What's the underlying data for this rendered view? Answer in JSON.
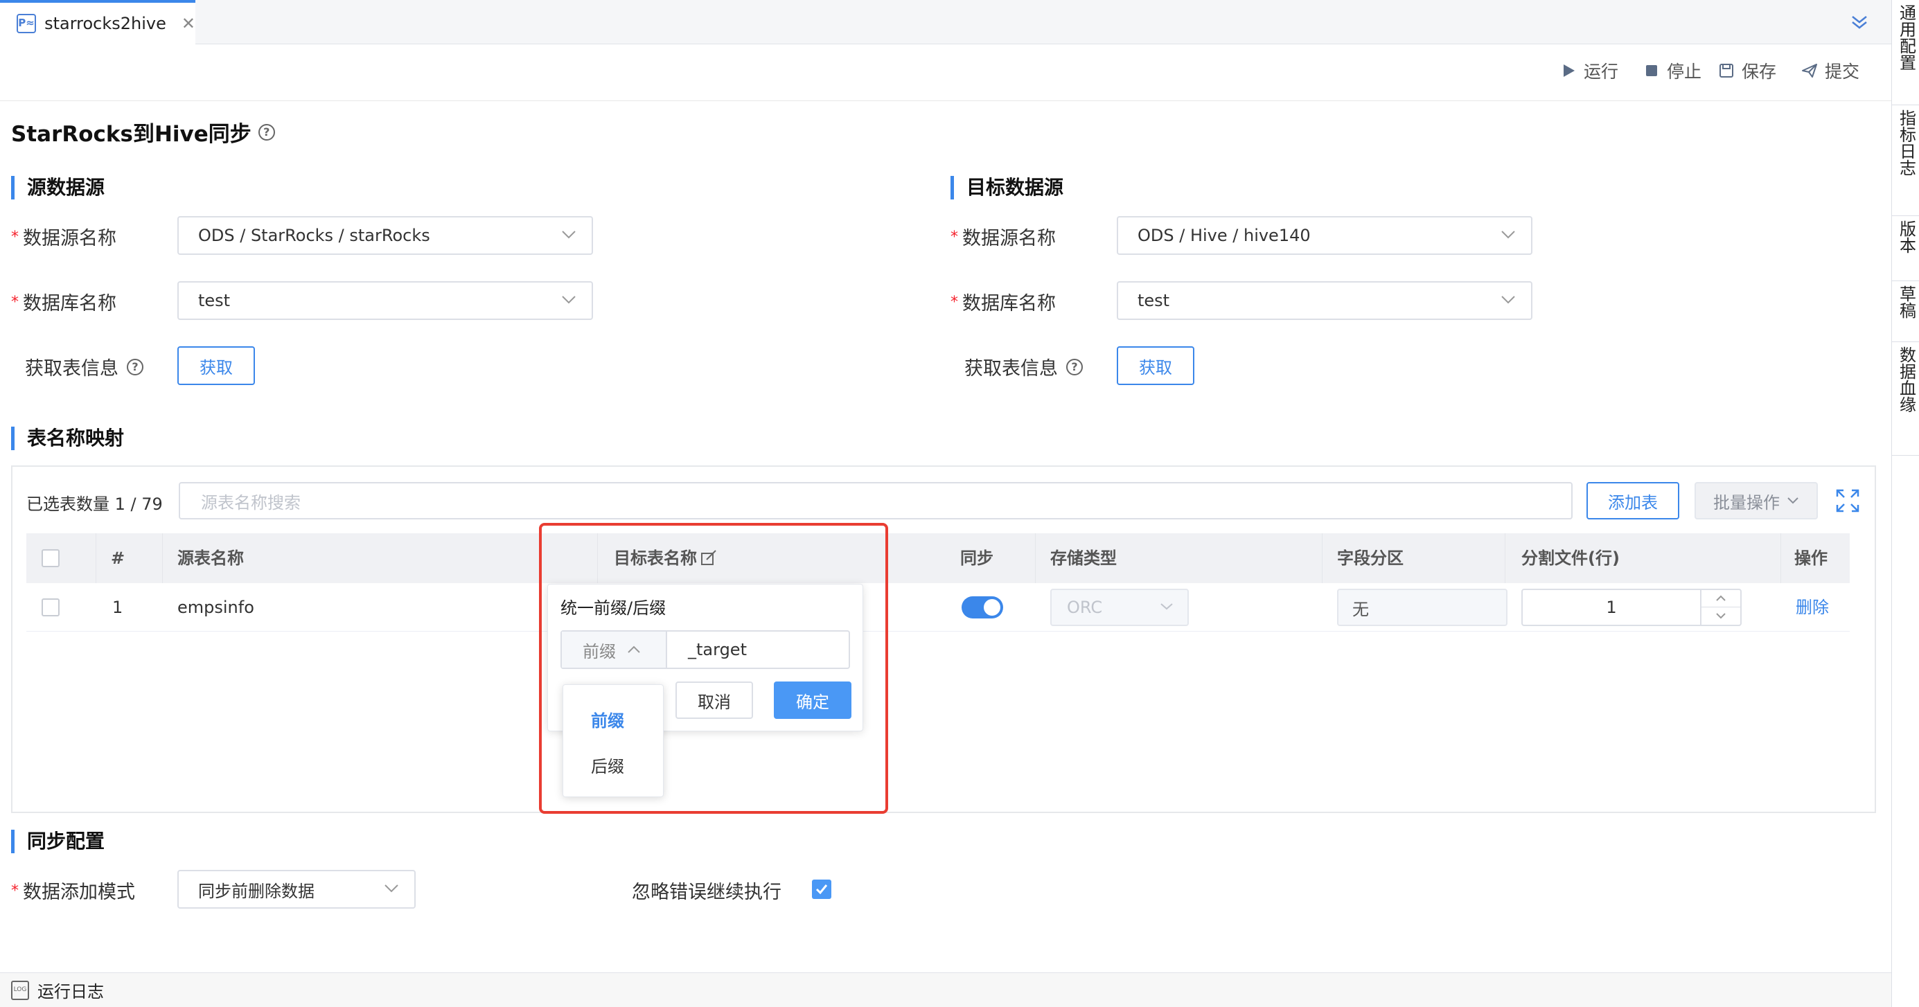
{
  "tab": {
    "label": "starrocks2hive",
    "logo_text": "P≈"
  },
  "toolbar": {
    "run": "运行",
    "stop": "停止",
    "save": "保存",
    "submit": "提交"
  },
  "right_sidebar": [
    "通用配置",
    "指标日志",
    "版本",
    "草稿",
    "数据血缘"
  ],
  "page_title": "StarRocks到Hive同步",
  "source": {
    "section": "源数据源",
    "ds_label": "数据源名称",
    "ds_value": "ODS / StarRocks / starRocks",
    "db_label": "数据库名称",
    "db_value": "test",
    "fetch_label": "获取表信息",
    "fetch_button": "获取"
  },
  "target": {
    "section": "目标数据源",
    "ds_label": "数据源名称",
    "ds_value": "ODS / Hive / hive140",
    "db_label": "数据库名称",
    "db_value": "test",
    "fetch_label": "获取表信息",
    "fetch_button": "获取"
  },
  "mapping": {
    "section": "表名称映射",
    "selected_count": "已选表数量 1 / 79",
    "search_placeholder": "源表名称搜索",
    "add_table": "添加表",
    "batch_ops": "批量操作",
    "columns": [
      "#",
      "源表名称",
      "目标表名称",
      "同步",
      "存储类型",
      "字段分区",
      "分割文件(行)",
      "操作"
    ],
    "rows": [
      {
        "index": "1",
        "source_table": "empsinfo",
        "sync": true,
        "storage": "ORC",
        "partition": "无",
        "split_rows": "1",
        "action": "删除"
      }
    ]
  },
  "popover": {
    "title": "统一前缀/后缀",
    "mode_selected": "前缀",
    "value": "_target",
    "cancel": "取消",
    "confirm": "确定",
    "options": [
      "前缀",
      "后缀"
    ]
  },
  "sync_config": {
    "section": "同步配置",
    "mode_label": "数据添加模式",
    "mode_value": "同步前删除数据",
    "ignore_label": "忽略错误继续执行",
    "ignore_checked": true
  },
  "bottom": {
    "log_label": "运行日志",
    "log_icon_text": "LOG"
  },
  "colors": {
    "accent": "#3b87ea",
    "highlight_box": "#e93d32",
    "required": "#f5222d"
  }
}
